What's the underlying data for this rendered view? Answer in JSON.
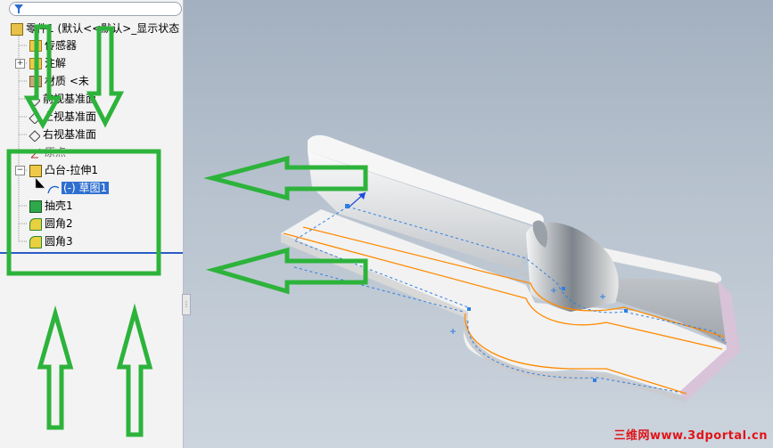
{
  "feature_tree": {
    "root_label": "零件1 (默认<<默认>_显示状态",
    "items": [
      {
        "label": "传感器",
        "icon": "sensor-folder-icon"
      },
      {
        "label": "注解",
        "icon": "annotation-folder-icon"
      },
      {
        "label": "材质 <未",
        "icon": "material-icon"
      },
      {
        "label": "前视基准面",
        "icon": "plane-icon"
      },
      {
        "label": "上视基准面",
        "icon": "plane-icon"
      },
      {
        "label": "右视基准面",
        "icon": "plane-icon"
      },
      {
        "label": "原点",
        "icon": "origin-icon"
      },
      {
        "label": "凸台-拉伸1",
        "icon": "boss-extrude-icon"
      },
      {
        "label": "(-) 草图1",
        "icon": "sketch-icon"
      },
      {
        "label": "抽壳1",
        "icon": "shell-icon"
      },
      {
        "label": "圆角2",
        "icon": "fillet-icon"
      },
      {
        "label": "圆角3",
        "icon": "fillet-icon"
      }
    ]
  },
  "watermark": "三维网www.3dportal.cn",
  "colors": {
    "annotation_green": "#2db33b",
    "edge_orange": "#ff8a00",
    "sketch_blue": "#2f7fe0",
    "selection_blue": "#2f6fd0"
  }
}
